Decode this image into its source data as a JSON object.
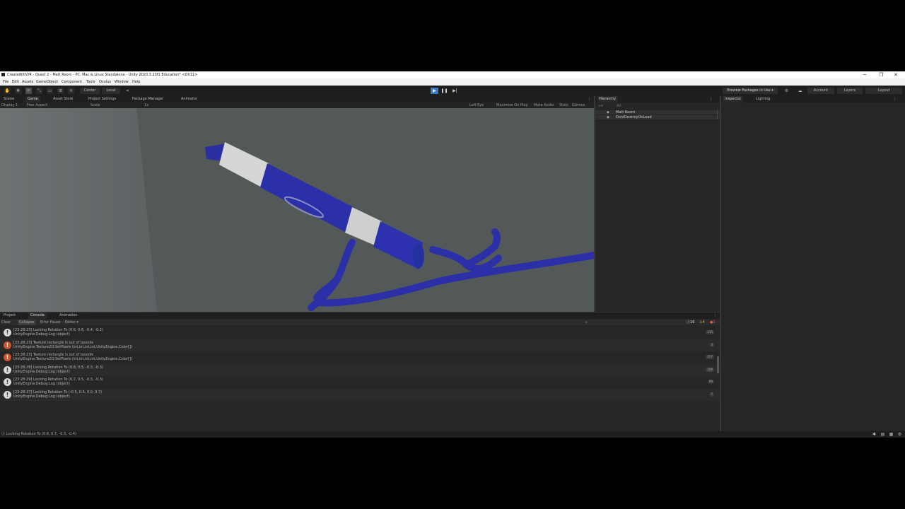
{
  "window": {
    "title": "CreateWithVR - Quest 2 - Matt Room - PC, Mac & Linux Standalone - Unity 2020.3.23f1 Education* <DX11>",
    "controls": [
      "─",
      "❐",
      "✕"
    ]
  },
  "menu": [
    "File",
    "Edit",
    "Assets",
    "GameObject",
    "Component",
    "Tools",
    "Oculus",
    "Window",
    "Help"
  ],
  "toolbar": {
    "pivot": "Center",
    "space": "Local",
    "preview_packages": "Preview Packages in Use ▾",
    "account": "Account",
    "layers": "Layers",
    "layout": "Layout"
  },
  "game_panel": {
    "tabs": [
      "Scene",
      "Game",
      "Asset Store",
      "Project Settings",
      "Package Manager",
      "Animator"
    ],
    "display": "Display 1",
    "aspect": "Free Aspect",
    "scale_label": "Scale",
    "scale_value": "1x",
    "eye": "Left Eye",
    "maximize": "Maximize On Play",
    "mute": "Mute Audio",
    "stats": "Stats",
    "gizmos": "Gizmos"
  },
  "hierarchy": {
    "tab": "Hierarchy",
    "search_placeholder": "All",
    "items": [
      "Matt Room",
      "DontDestroyOnLoad"
    ]
  },
  "inspector": {
    "tabs": [
      "Inspector",
      "Lighting"
    ]
  },
  "bottom_panel": {
    "tabs": [
      "Project",
      "Console",
      "Animation"
    ],
    "toolbar": {
      "clear": "Clear",
      "collapse": "Collapse",
      "error_pause": "Error Pause",
      "editor": "Editor ▾"
    },
    "counts": {
      "info": "16",
      "warn": "4",
      "error": "2"
    },
    "logs": [
      {
        "type": "info",
        "line1": "[23:28:23] Locking Rotation To (0.6, 0.6, -0.4, -0.2)",
        "line2": "UnityEngine.Debug:Log (object)",
        "count": "115"
      },
      {
        "type": "error",
        "line1": "[23:28:23] Texture rectangle is out of bounds",
        "line2": "UnityEngine.Texture2D:SetPixels (int,int,int,int,UnityEngine.Color[])",
        "count": "3"
      },
      {
        "type": "error",
        "line1": "[23:28:23] Texture rectangle is out of bounds",
        "line2": "UnityEngine.Texture2D:SetPixels (int,int,int,int,UnityEngine.Color[])",
        "count": "277"
      },
      {
        "type": "info",
        "line1": "[23:28:28] Locking Rotation To (0.8, 0.5, -0.3, -0.3)",
        "line2": "UnityEngine.Debug:Log (object)",
        "count": "208"
      },
      {
        "type": "info",
        "line1": "[23:28:29] Locking Rotation To (0.7, 0.5, -0.3, -0.3)",
        "line2": "UnityEngine.Debug:Log (object)",
        "count": "99"
      },
      {
        "type": "info",
        "line1": "[23:28:37] Locking Rotation To (-0.5, 0.5, 0.0, 0.7)",
        "line2": "UnityEngine.Debug:Log (object)",
        "count": "7"
      }
    ]
  },
  "status": {
    "message": "Locking Rotation To (0.8, 0.7, -0.3, -0.4)"
  },
  "colors": {
    "marker_blue": "#2b2fa8",
    "error_red": "#d2542d",
    "info_gray": "#d9d9d9",
    "play_active": "#3a79c4"
  }
}
